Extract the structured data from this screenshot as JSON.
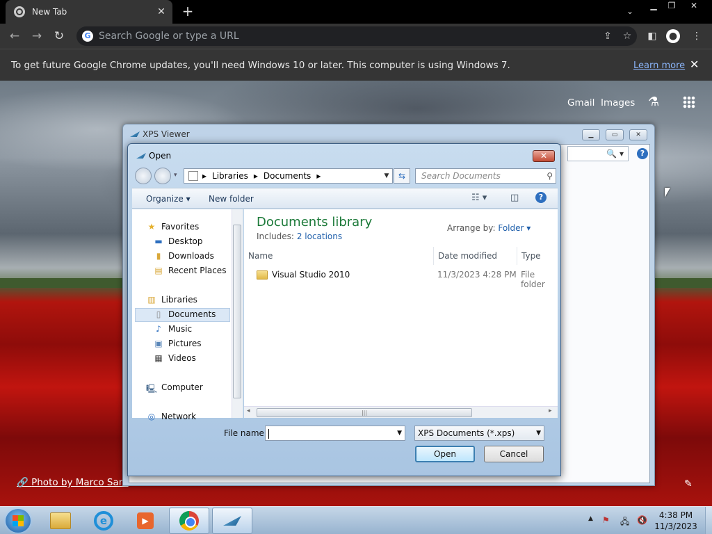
{
  "browser": {
    "tab_title": "New Tab",
    "omnibox_placeholder": "Search Google or type a URL",
    "infobar_message": "To get future Google Chrome updates, you'll need Windows 10 or later. This computer is using Windows 7.",
    "infobar_link": "Learn more"
  },
  "ntp": {
    "gmail": "Gmail",
    "images": "Images",
    "photo_credit": "Photo by Marco Sant"
  },
  "xps_window": {
    "title": "XPS Viewer"
  },
  "open_dialog": {
    "title": "Open",
    "breadcrumb": [
      "Libraries",
      "Documents"
    ],
    "search_placeholder": "Search Documents",
    "organize": "Organize",
    "new_folder": "New folder",
    "nav": {
      "favorites": "Favorites",
      "desktop": "Desktop",
      "downloads": "Downloads",
      "recent_places": "Recent Places",
      "libraries": "Libraries",
      "documents": "Documents",
      "music": "Music",
      "pictures": "Pictures",
      "videos": "Videos",
      "computer": "Computer",
      "network": "Network"
    },
    "library_title": "Documents library",
    "includes_label": "Includes:",
    "includes_link": "2 locations",
    "arrange_label": "Arrange by:",
    "arrange_value": "Folder",
    "columns": [
      "Name",
      "Date modified",
      "Type"
    ],
    "files": [
      {
        "name": "Visual Studio 2010",
        "date": "11/3/2023 4:28 PM",
        "type": "File folder"
      }
    ],
    "file_name_label": "File name:",
    "file_name_value": "",
    "file_type": "XPS Documents (*.xps)",
    "open_button": "Open",
    "cancel_button": "Cancel"
  },
  "taskbar": {
    "time": "4:38 PM",
    "date": "11/3/2023"
  }
}
